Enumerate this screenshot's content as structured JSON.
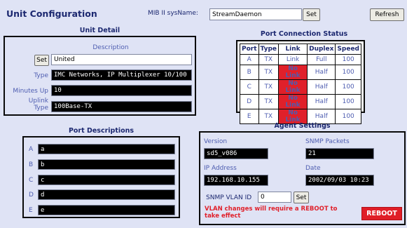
{
  "header": {
    "title": "Unit Configuration",
    "mib_label": "MIB II sysName:",
    "sysname_value": "StreamDaemon",
    "set_label": "Set",
    "refresh_label": "Refresh"
  },
  "unit_detail": {
    "title": "Unit Detail",
    "description_label": "Description",
    "set_label": "Set",
    "description_value": "United",
    "type_label": "Type",
    "type_value": "IMC Networks, IP Multiplexer 10/100",
    "minutes_label": "Minutes Up",
    "minutes_value": "10",
    "uplink_label_1": "Uplink",
    "uplink_label_2": "Type",
    "uplink_value": "100Base-TX"
  },
  "port_status": {
    "title": "Port Connection Status",
    "headers": [
      "Port",
      "Type",
      "Link",
      "Duplex",
      "Speed"
    ],
    "rows": [
      {
        "port": "A",
        "type": "TX",
        "link": "Link",
        "duplex": "Full",
        "speed": "100"
      },
      {
        "port": "B",
        "type": "TX",
        "link": "No Link",
        "duplex": "Half",
        "speed": "100"
      },
      {
        "port": "C",
        "type": "TX",
        "link": "No Link",
        "duplex": "Half",
        "speed": "100"
      },
      {
        "port": "D",
        "type": "TX",
        "link": "No Link",
        "duplex": "Half",
        "speed": "100"
      },
      {
        "port": "E",
        "type": "TX",
        "link": "No Link",
        "duplex": "Half",
        "speed": "100"
      }
    ]
  },
  "port_descriptions": {
    "title": "Port Descriptions",
    "items": [
      {
        "label": "A",
        "value": "a"
      },
      {
        "label": "B",
        "value": "b"
      },
      {
        "label": "C",
        "value": "c"
      },
      {
        "label": "D",
        "value": "d"
      },
      {
        "label": "E",
        "value": "e"
      }
    ]
  },
  "agent": {
    "title": "Agent Settings",
    "version_label": "Version",
    "version_value": "sd5_v086",
    "snmp_packets_label": "SNMP Packets",
    "snmp_packets_value": "21",
    "ip_label": "IP Address",
    "ip_value": "192.168.10.155",
    "date_label": "Date",
    "date_value": "2002/09/03 10:23",
    "vlan_label": "SNMP VLAN ID",
    "vlan_value": "0",
    "set_label": "Set",
    "warning": "VLAN changes will require a REBOOT to take effect",
    "reboot_label": "REBOOT"
  },
  "colors": {
    "background": "#dfe3f5",
    "heading": "#1c2870",
    "label": "#4d5cb0",
    "no_link_bg": "#e0202a",
    "link_text": "#3a9a3a",
    "reboot_bg": "#e01e27"
  }
}
